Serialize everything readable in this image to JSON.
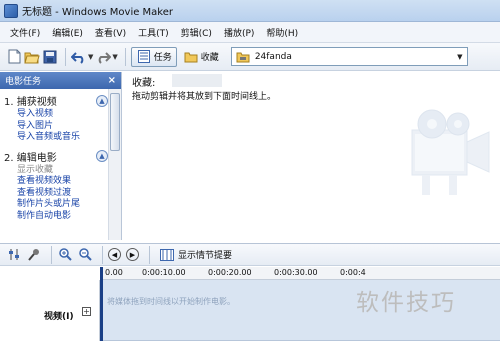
{
  "window": {
    "title": "无标题 - Windows Movie Maker"
  },
  "menu": [
    {
      "label": "文件(F)"
    },
    {
      "label": "编辑(E)"
    },
    {
      "label": "查看(V)"
    },
    {
      "label": "工具(T)"
    },
    {
      "label": "剪辑(C)"
    },
    {
      "label": "播放(P)"
    },
    {
      "label": "帮助(H)"
    }
  ],
  "toolbar": {
    "tasks_label": "任务",
    "collections_label": "收藏",
    "collection_selected": "24fanda"
  },
  "task_pane": {
    "header": "电影任务",
    "close_glyph": "×",
    "sections": [
      {
        "title": "1.  捕获视频",
        "links": [
          "导入视频",
          "导入图片",
          "导入音频或音乐"
        ]
      },
      {
        "title": "2.  编辑电影",
        "links": [
          "显示收藏",
          "查看视频效果",
          "查看视频过渡",
          "制作片头或片尾",
          "制作自动电影"
        ]
      }
    ]
  },
  "collection": {
    "title": "收藏:",
    "instruction": "拖动剪辑并将其放到下面时间线上。"
  },
  "timeline_toolbar": {
    "storyboard_label": "显示情节提要"
  },
  "timeline": {
    "ruler": [
      "0.00",
      "0:00:10.00",
      "0:00:20.00",
      "0:00:30.00",
      "0:00:4"
    ],
    "track_label": "视频(I)",
    "expand_glyph": "⊞",
    "drop_hint": "将媒体拖到时间线以开始制作电影。"
  },
  "watermark": "软件技巧",
  "colors": {
    "taskpane_header": "#3d67ae",
    "link": "#1a44a8",
    "video_track": "#d9e4f2",
    "playhead": "#1a3f86"
  }
}
